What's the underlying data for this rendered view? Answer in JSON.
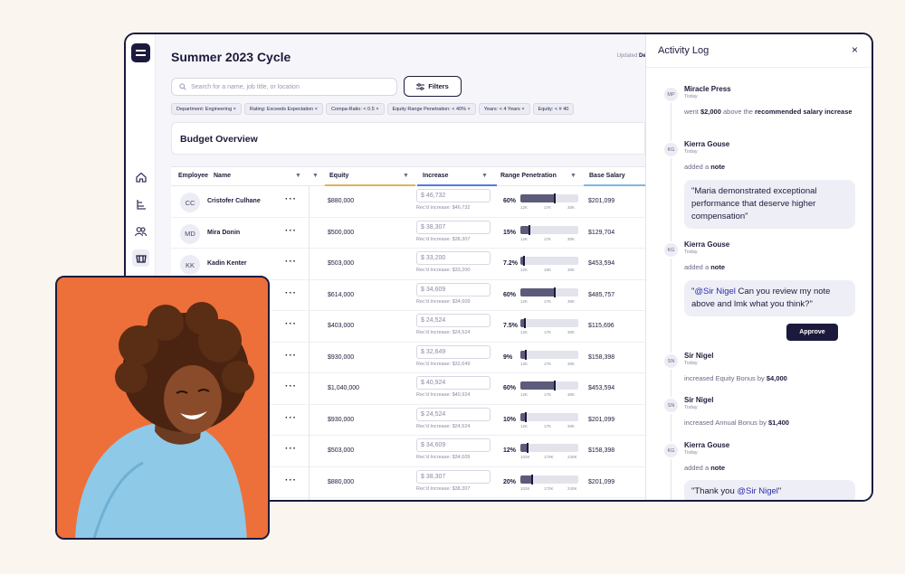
{
  "header": {
    "title": "Summer 2023 Cycle",
    "updated_prefix": "Updated",
    "updated_value": "Dec"
  },
  "search": {
    "placeholder": "Search for a name, job title, or location"
  },
  "filters_label": "Filters",
  "chips": [
    "Department: Engineering  ×",
    "Rating: Exceeds Expectation  ×",
    "Compa-Ratio: < 0.5  ×",
    "Equity Range Penetration: < 40%  ×",
    "Years: < 4 Years  ×",
    "Equity: < # 40"
  ],
  "overview_title": "Budget Overview",
  "columns": {
    "employee": "Employee",
    "name": "Name",
    "equity": "Equity",
    "increase": "Increase",
    "range": "Range Penetration",
    "salary": "Base Salary"
  },
  "rows": [
    {
      "initials": "CC",
      "name": "Cristofer Culhane",
      "equity": "$880,000",
      "increase": "$ 46,732",
      "rec": "Rec'd Increase: $46,732",
      "pct": "60%",
      "fill": 0.6,
      "ticks": [
        "12K",
        "17K",
        "30K"
      ],
      "salary": "$201,099"
    },
    {
      "initials": "MD",
      "name": "Mira Donin",
      "equity": "$500,000",
      "increase": "$ 38,307",
      "rec": "Rec'd Increase: $38,307",
      "pct": "15%",
      "fill": 0.15,
      "ticks": [
        "12K",
        "17K",
        "30K"
      ],
      "salary": "$129,704"
    },
    {
      "initials": "KK",
      "name": "Kadin Kenter",
      "equity": "$503,000",
      "increase": "$ 33,200",
      "rec": "Rec'd Increase: $33,200",
      "pct": "7.2%",
      "fill": 0.07,
      "ticks": [
        "12K",
        "15K",
        "30K"
      ],
      "salary": "$453,594"
    },
    {
      "initials": "",
      "name": "",
      "equity": "$614,000",
      "increase": "$ 34,609",
      "rec": "Rec'd Increase: $34,609",
      "pct": "60%",
      "fill": 0.6,
      "ticks": [
        "12K",
        "17K",
        "30K"
      ],
      "salary": "$485,757"
    },
    {
      "initials": "",
      "name": "",
      "equity": "$403,000",
      "increase": "$ 24,524",
      "rec": "Rec'd Increase: $24,524",
      "pct": "7.5%",
      "fill": 0.075,
      "ticks": [
        "12K",
        "17K",
        "30K"
      ],
      "salary": "$115,696"
    },
    {
      "initials": "",
      "name": "",
      "equity": "$930,000",
      "increase": "$ 32,649",
      "rec": "Rec'd Increase: $32,649",
      "pct": "9%",
      "fill": 0.09,
      "ticks": [
        "12K",
        "17K",
        "30K"
      ],
      "salary": "$158,398"
    },
    {
      "initials": "",
      "name": "",
      "equity": "$1,040,000",
      "increase": "$ 40,924",
      "rec": "Rec'd Increase: $40,924",
      "pct": "60%",
      "fill": 0.6,
      "ticks": [
        "12K",
        "17K",
        "30K"
      ],
      "salary": "$453,594"
    },
    {
      "initials": "",
      "name": "",
      "equity": "$930,000",
      "increase": "$ 24,524",
      "rec": "Rec'd Increase: $24,524",
      "pct": "10%",
      "fill": 0.1,
      "ticks": [
        "12K",
        "17K",
        "30K"
      ],
      "salary": "$201,099"
    },
    {
      "initials": "",
      "name": "",
      "equity": "$503,000",
      "increase": "$ 34,609",
      "rec": "Rec'd Increase: $34,609",
      "pct": "12%",
      "fill": 0.12,
      "ticks": [
        "102K",
        "170K",
        "240K"
      ],
      "salary": "$158,398"
    },
    {
      "initials": "",
      "name": "",
      "equity": "$880,000",
      "increase": "$ 38,307",
      "rec": "Rec'd Increase: $38,307",
      "pct": "20%",
      "fill": 0.2,
      "ticks": [
        "102K",
        "170K",
        "240K"
      ],
      "salary": "$201,099"
    }
  ],
  "activity": {
    "title": "Activity Log",
    "close": "×",
    "entries": [
      {
        "initials": "MP",
        "name": "Miracle Press",
        "time": "Today",
        "text_pre": "went ",
        "amount": "$2,000",
        "text_mid": " above the ",
        "bold2": "recommended salary increase"
      },
      {
        "initials": "KG",
        "name": "Kierra Gouse",
        "time": "Today",
        "action": "added a",
        "obj": "note",
        "note": "\"Maria demonstrated exceptional performance that deserve higher compensation\""
      },
      {
        "initials": "KG",
        "name": "Kierra Gouse",
        "time": "Today",
        "action": "added a",
        "obj": "note",
        "mention": "@Sir Nigel",
        "note_rest": " Can you review my note above and lmk what you think?\""
      },
      {
        "initials": "SN",
        "name": "Sir Nigel",
        "time": "Today",
        "text": "increased Equity Bonus by ",
        "amount": "$4,000"
      },
      {
        "initials": "SN",
        "name": "Sir Nigel",
        "time": "Today",
        "text": "increased Annual Bonus by ",
        "amount": "$1,400"
      },
      {
        "initials": "KG",
        "name": "Kierra Gouse",
        "time": "Today",
        "action": "added a",
        "obj": "note",
        "note_pre": "\"Thank you ",
        "mention": "@Sir Nigel",
        "note_end": "\""
      }
    ],
    "approve_label": "Approve"
  },
  "colors": {
    "navy": "#1c1a3c",
    "photo_bg": "#ed6f3a",
    "accent_equity": "#e0b35a",
    "accent_increase": "#4e7de0",
    "accent_salary": "#7bb7e8"
  }
}
